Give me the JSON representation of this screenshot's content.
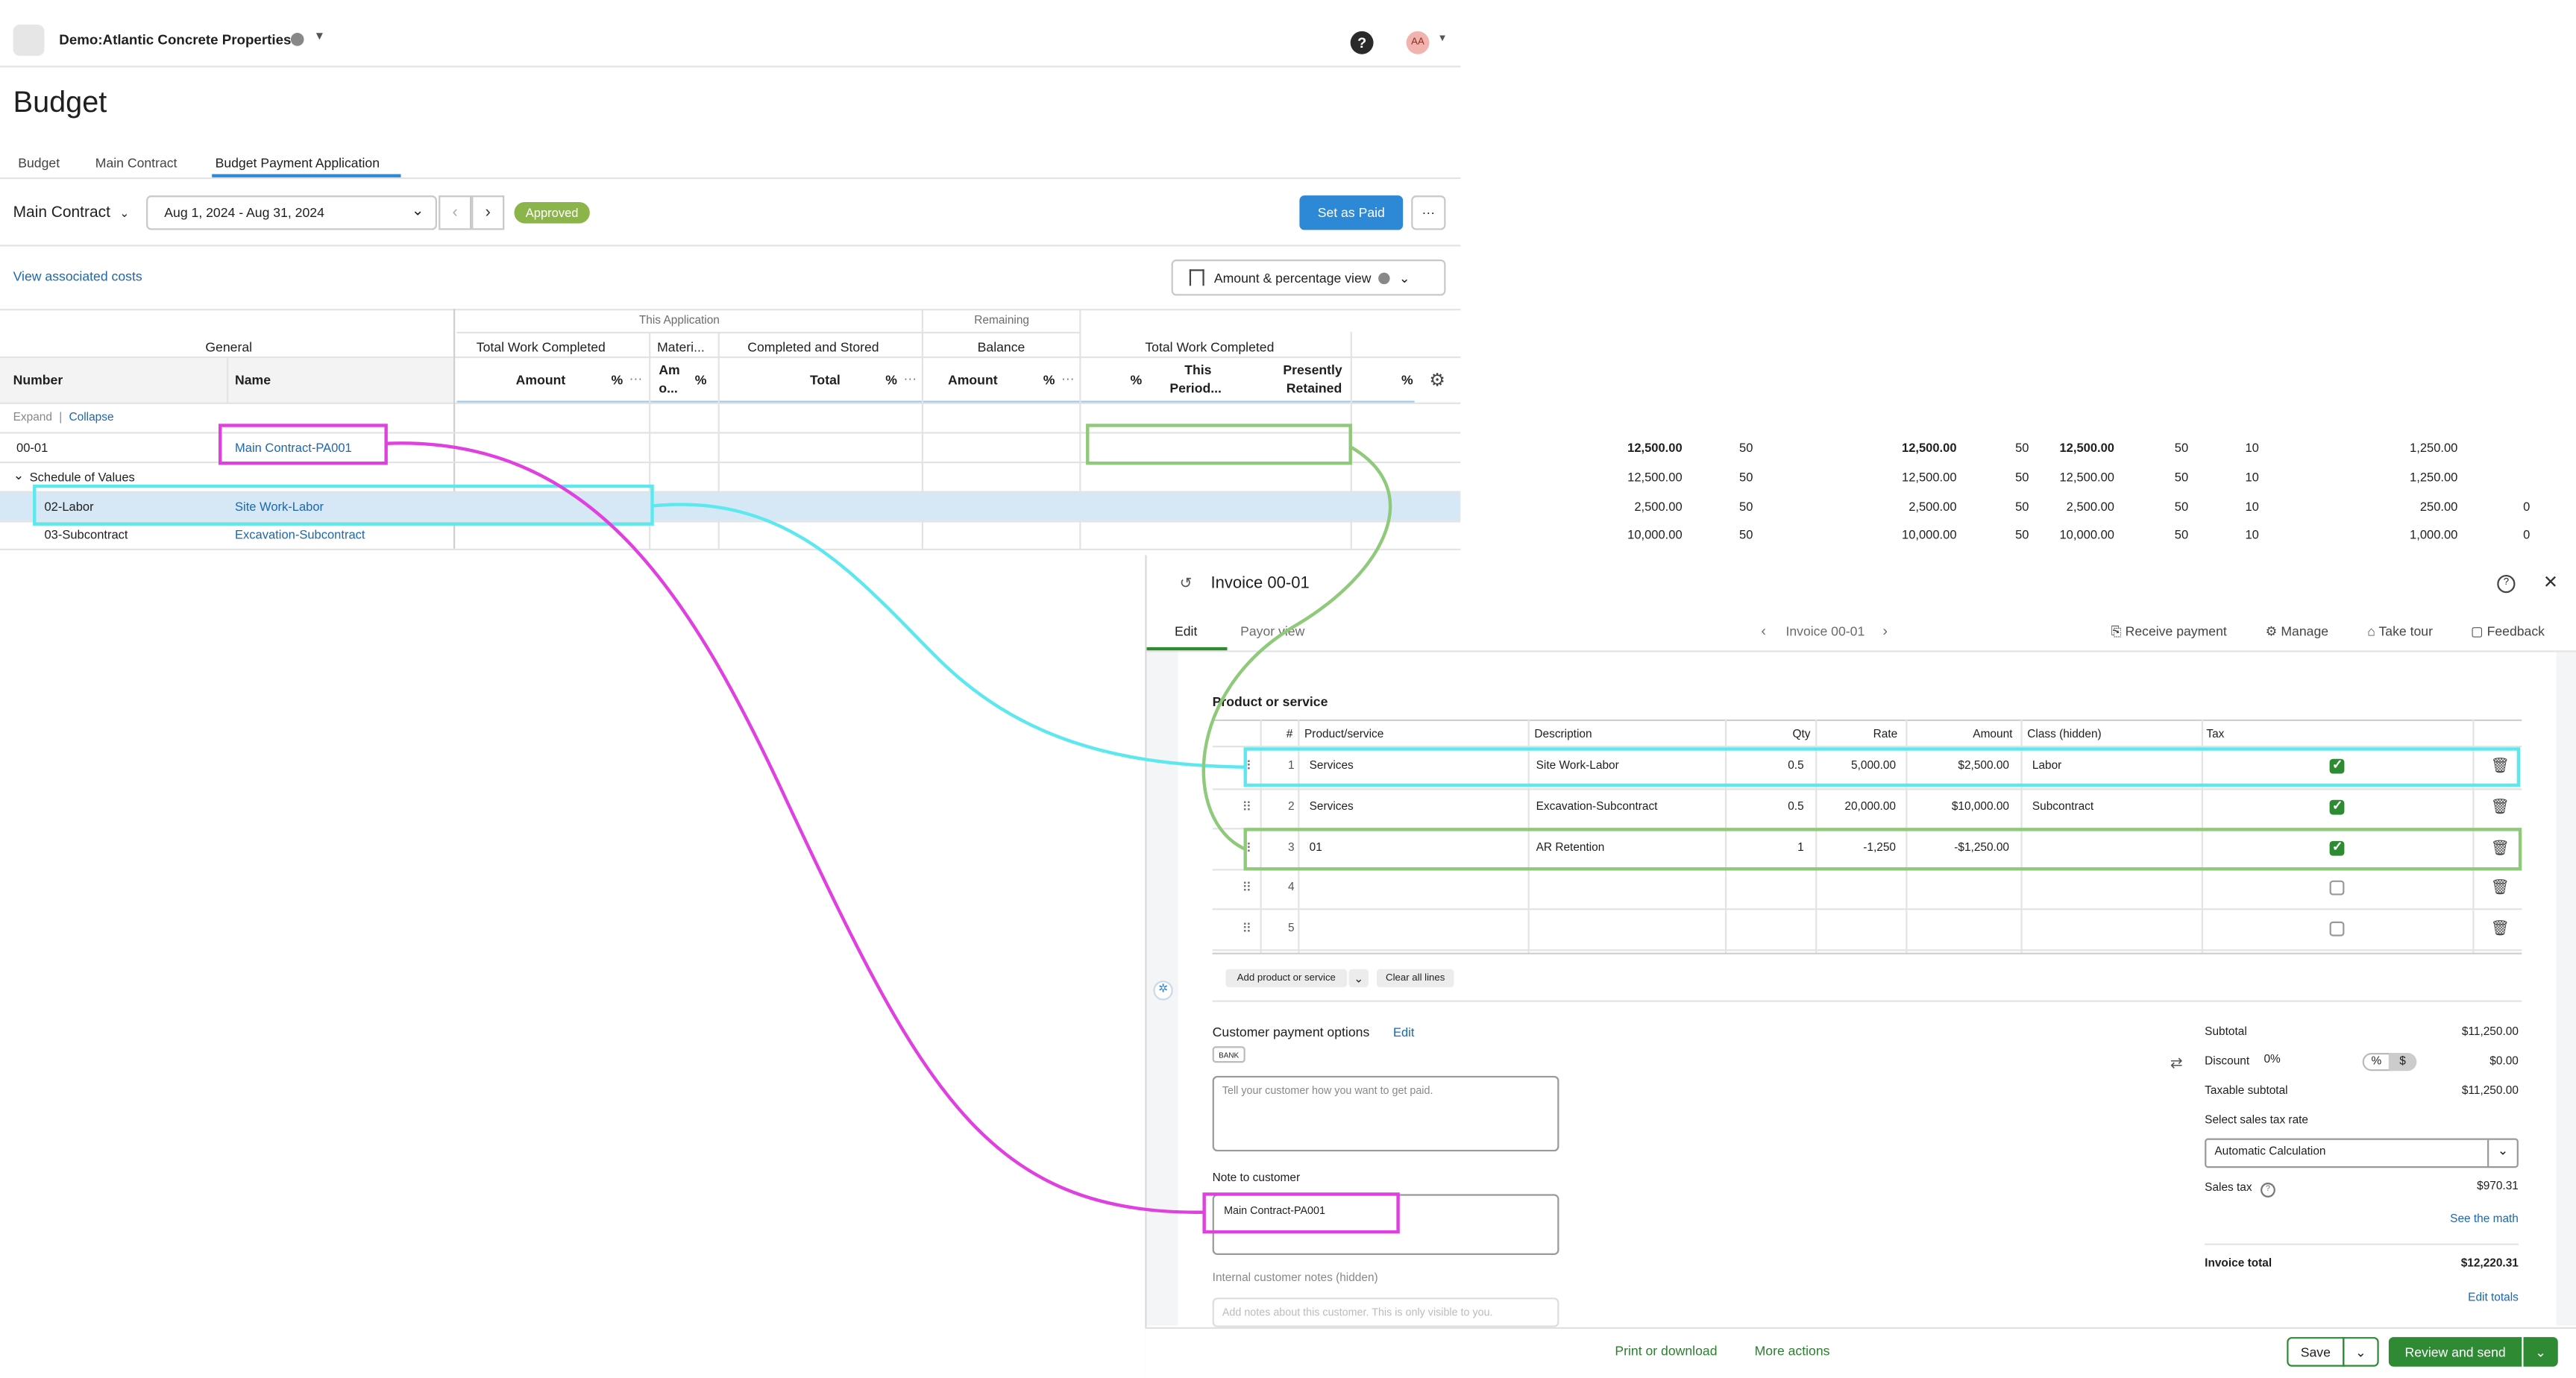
{
  "header": {
    "company": "Demo:Atlantic Concrete Properties",
    "help": "?",
    "avatar_initials": "AA"
  },
  "page": {
    "title": "Budget"
  },
  "tabs": [
    {
      "label": "Budget"
    },
    {
      "label": "Main Contract"
    },
    {
      "label": "Budget Payment Application"
    }
  ],
  "toolbar": {
    "contract_select": "Main Contract",
    "date_range": "Aug 1, 2024 - Aug 31, 2024",
    "status_badge": "Approved",
    "set_paid_button": "Set as Paid",
    "more": "···",
    "view_costs_link": "View associated costs",
    "view_mode": "Amount & percentage view"
  },
  "grid": {
    "group_this_application": "This Application",
    "group_remaining": "Remaining",
    "sub_general": "General",
    "sub_total_work": "Total Work Completed",
    "sub_materials": "Materi...",
    "sub_completed_stored": "Completed and Stored",
    "sub_balance": "Balance",
    "sub_total_work2": "Total Work Completed",
    "col_number": "Number",
    "col_name": "Name",
    "col_amount": "Amount",
    "col_pct": "%",
    "col_dots": "···",
    "col_amo_1": "Am",
    "col_amo_2": "o...",
    "col_total": "Total",
    "col_this_period_1": "This",
    "col_this_period_2": "Period...",
    "col_presently_1": "Presently",
    "col_presently_2": "Retained",
    "expand": "Expand",
    "sep": "|",
    "collapse": "Collapse",
    "rows": [
      {
        "number": "00-01",
        "name": "Main Contract-PA001",
        "amount": "12,500.00",
        "pct": "50",
        "total": "12,500.00",
        "pct2": "50",
        "balance": "12,500.00",
        "pct3": "50",
        "pct4": "10",
        "retained": "1,250.00",
        "last": ""
      },
      {
        "number": "Schedule of Values",
        "name": "",
        "amount": "12,500.00",
        "pct": "50",
        "total": "12,500.00",
        "pct2": "50",
        "balance": "12,500.00",
        "pct3": "50",
        "pct4": "10",
        "retained": "1,250.00",
        "last": ""
      },
      {
        "number": "02-Labor",
        "name": "Site Work-Labor",
        "amount": "2,500.00",
        "pct": "50",
        "total": "2,500.00",
        "pct2": "50",
        "balance": "2,500.00",
        "pct3": "50",
        "pct4": "10",
        "retained": "250.00",
        "last": "0"
      },
      {
        "number": "03-Subcontract",
        "name": "Excavation-Subcontract",
        "amount": "10,000.00",
        "pct": "50",
        "total": "10,000.00",
        "pct2": "50",
        "balance": "10,000.00",
        "pct3": "50",
        "pct4": "10",
        "retained": "1,000.00",
        "last": "0"
      }
    ]
  },
  "invoice": {
    "title": "Invoice 00-01",
    "tab_edit": "Edit",
    "tab_payor": "Payor view",
    "nav_label": "Invoice 00-01",
    "receive_payment": "Receive payment",
    "manage": "Manage",
    "take_tour": "Take tour",
    "feedback": "Feedback",
    "section_title": "Product or service",
    "cols": {
      "num": "#",
      "product": "Product/service",
      "desc": "Description",
      "qty": "Qty",
      "rate": "Rate",
      "amount": "Amount",
      "class": "Class (hidden)",
      "tax": "Tax"
    },
    "lines": [
      {
        "n": "1",
        "product": "Services",
        "desc": "Site Work-Labor",
        "qty": "0.5",
        "rate": "5,000.00",
        "amount": "$2,500.00",
        "class": "Labor",
        "tax": true
      },
      {
        "n": "2",
        "product": "Services",
        "desc": "Excavation-Subcontract",
        "qty": "0.5",
        "rate": "20,000.00",
        "amount": "$10,000.00",
        "class": "Subcontract",
        "tax": true
      },
      {
        "n": "3",
        "product": "01",
        "desc": "AR Retention",
        "qty": "1",
        "rate": "-1,250",
        "amount": "-$1,250.00",
        "class": "",
        "tax": true
      },
      {
        "n": "4",
        "product": "",
        "desc": "",
        "qty": "",
        "rate": "",
        "amount": "",
        "class": "",
        "tax": false
      },
      {
        "n": "5",
        "product": "",
        "desc": "",
        "qty": "",
        "rate": "",
        "amount": "",
        "class": "",
        "tax": false
      }
    ],
    "add_product": "Add product or service",
    "clear_lines": "Clear all lines",
    "payment_options": "Customer payment options",
    "payment_edit": "Edit",
    "bank_badge": "BANK",
    "payment_placeholder": "Tell your customer how you want to get paid.",
    "note_label": "Note to customer",
    "note_value": "Main Contract-PA001",
    "internal_label": "Internal customer notes (hidden)",
    "internal_placeholder": "Add notes about this customer. This is only visible to you.",
    "subtotal_label": "Subtotal",
    "subtotal": "$11,250.00",
    "discount_label": "Discount",
    "discount_pct": "0%",
    "discount_pct_btn": "%",
    "discount_dollar_btn": "$",
    "discount": "$0.00",
    "taxable_label": "Taxable subtotal",
    "taxable": "$11,250.00",
    "tax_rate_label": "Select sales tax rate",
    "tax_rate": "Automatic Calculation",
    "sales_tax_label": "Sales tax",
    "sales_tax": "$970.31",
    "see_math": "See the math",
    "total_label": "Invoice total",
    "total": "$12,220.31",
    "edit_totals": "Edit totals",
    "print": "Print or download",
    "more_actions": "More actions",
    "save": "Save",
    "review_send": "Review and send"
  },
  "colors": {
    "magenta": "#e040e0",
    "cyan": "#5de8f0",
    "green": "#8fc97a",
    "brand_green": "#2e8b34",
    "blue": "#2d88d6"
  }
}
